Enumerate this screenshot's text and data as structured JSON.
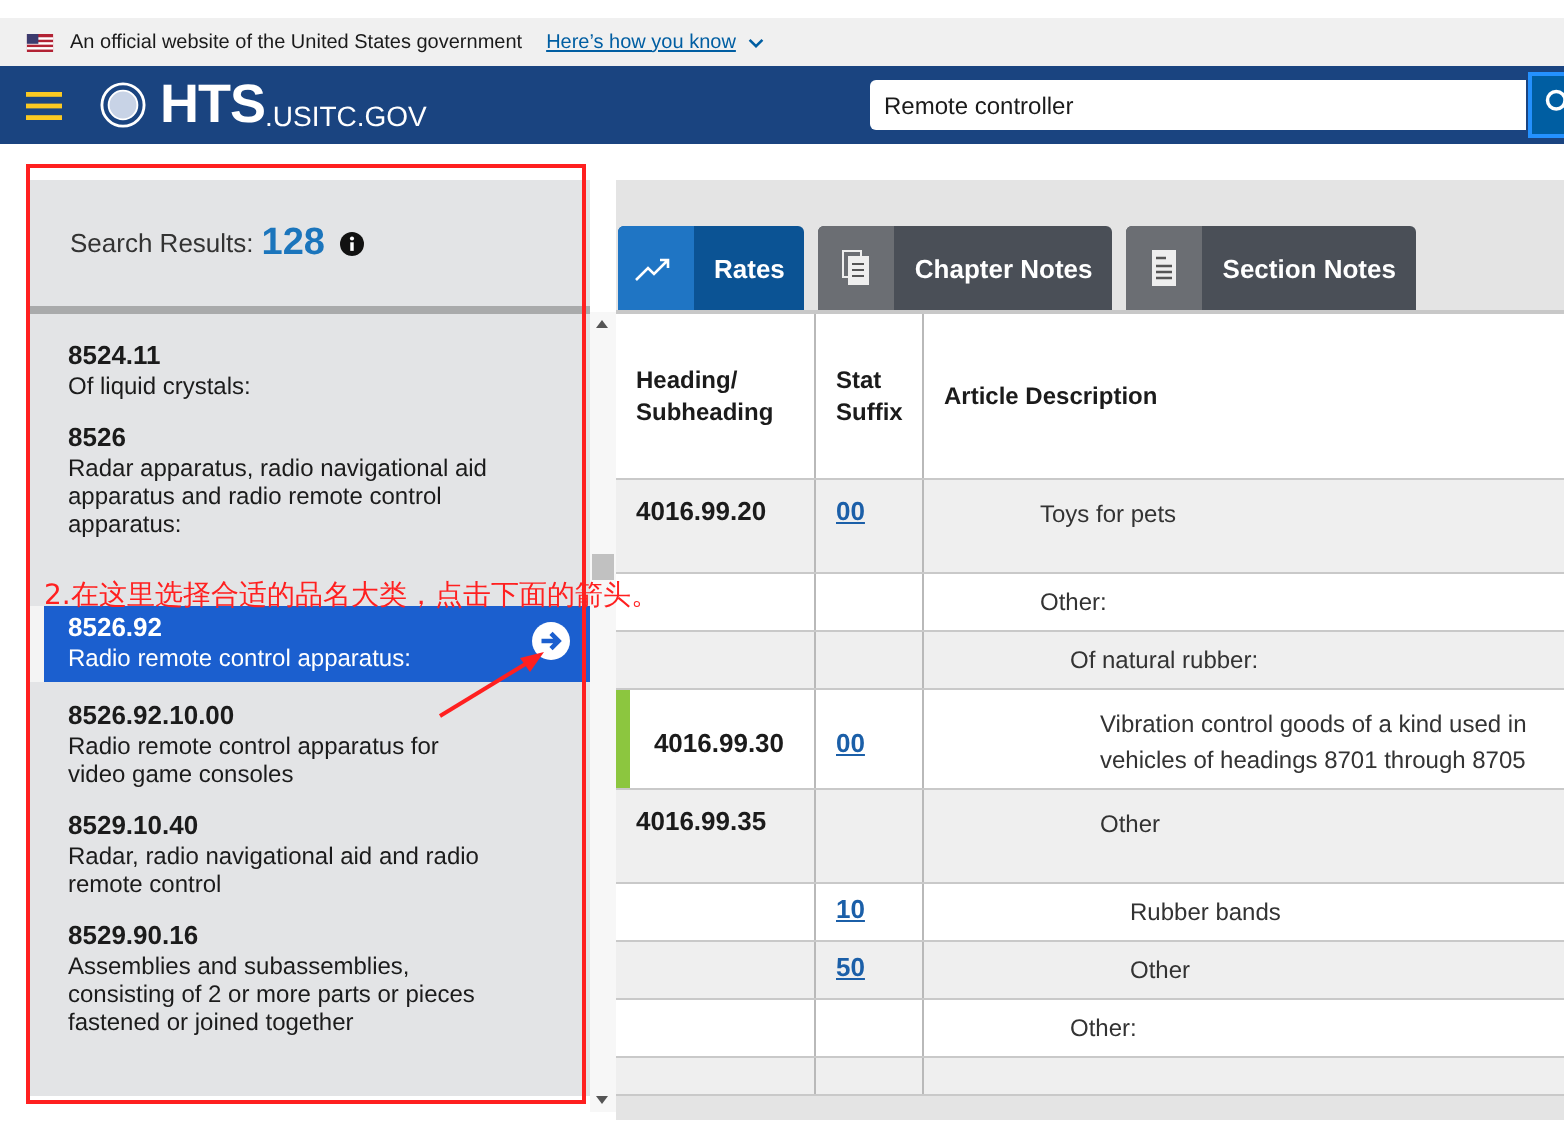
{
  "banner": {
    "text": "An official website of the United States government",
    "link": "Here’s how you know"
  },
  "header": {
    "logo_main": "HTS",
    "logo_suffix": ".USITC.GOV",
    "search": {
      "value": "Remote controller"
    }
  },
  "sidebar": {
    "label": "Search Results:",
    "count": "128",
    "items": [
      {
        "code": "8524.11",
        "description": "Of liquid crystals:",
        "selected": false
      },
      {
        "code": "8526",
        "description": "Radar apparatus, radio navigational aid apparatus and radio remote control apparatus:",
        "selected": false
      },
      {
        "code": "8526.92",
        "description": "Radio remote control apparatus:",
        "selected": true
      },
      {
        "code": "8526.92.10.00",
        "description": "Radio remote control apparatus for video game consoles",
        "selected": false
      },
      {
        "code": "8529.10.40",
        "description": "Radar, radio navigational aid and radio remote control",
        "selected": false
      },
      {
        "code": "8529.90.16",
        "description": "Assemblies and subassemblies, consisting of 2 or more parts or pieces fastened or joined together",
        "selected": false
      }
    ]
  },
  "tabs": [
    {
      "label": "Rates",
      "selected": true
    },
    {
      "label": "Chapter Notes",
      "selected": false
    },
    {
      "label": "Section Notes",
      "selected": false
    }
  ],
  "table": {
    "columns": [
      "Heading/ Subheading",
      "Stat Suffix",
      "Article Description"
    ],
    "rows": [
      {
        "heading": "4016.99.20",
        "stat_suffix": "00",
        "description": "Toys for pets",
        "highlighted": false
      },
      {
        "description": "Other:",
        "highlighted": false,
        "children": [
          {
            "description": "Of natural rubber:",
            "highlighted": false,
            "children": [
              {
                "heading": "4016.99.30",
                "stat_suffix": "00",
                "description": "Vibration control goods of a kind used in vehicles of headings 8701 through 8705",
                "highlighted": true
              },
              {
                "heading": "4016.99.35",
                "description": "Other",
                "highlighted": false,
                "children": [
                  {
                    "stat_suffix": "10",
                    "description": "Rubber bands",
                    "highlighted": false
                  },
                  {
                    "stat_suffix": "50",
                    "description": "Other",
                    "highlighted": false
                  }
                ]
              }
            ]
          },
          {
            "description": "Other:",
            "highlighted": false
          }
        ]
      }
    ]
  },
  "annotation": {
    "text": "2.在这里选择合适的品名大类，点击下面的箭头。"
  }
}
